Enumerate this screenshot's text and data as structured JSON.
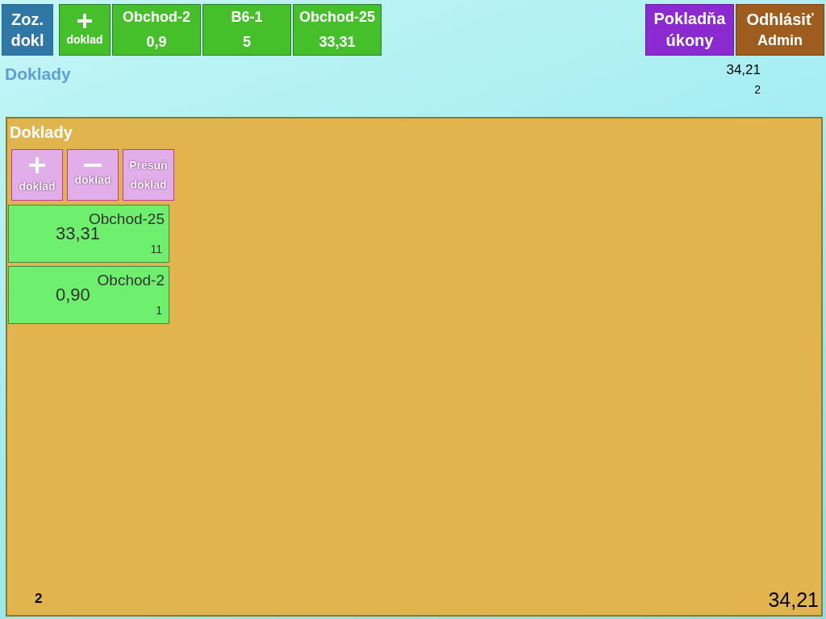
{
  "toolbar": {
    "list_button": {
      "lines": [
        "Zoz.",
        "dokl"
      ]
    },
    "new_button": {
      "label": "doklad"
    },
    "document_tabs": [
      {
        "name": "Obchod-2",
        "amount": "0,9"
      },
      {
        "name": "B6-1",
        "amount": "5"
      },
      {
        "name": "Obchod-25",
        "amount": "33,31"
      }
    ],
    "register_button": {
      "lines": [
        "Pokladňa",
        "úkony"
      ]
    },
    "logout_button": {
      "lines": [
        "Odhlásiť",
        "Admin"
      ]
    }
  },
  "header": {
    "title": "Doklady",
    "total": "34,21",
    "count": "2"
  },
  "panel": {
    "title": "Doklady",
    "actions": [
      {
        "kind": "add",
        "label": "doklad"
      },
      {
        "kind": "remove",
        "label": "doklad"
      },
      {
        "kind": "move",
        "lines": [
          "Presuň",
          "doklad"
        ]
      }
    ],
    "documents": [
      {
        "name": "Obchod-25",
        "amount": "33,31",
        "items": "11"
      },
      {
        "name": "Obchod-2",
        "amount": "0,90",
        "items": "1"
      }
    ],
    "footer": {
      "count": "2",
      "total": "34,21"
    }
  }
}
